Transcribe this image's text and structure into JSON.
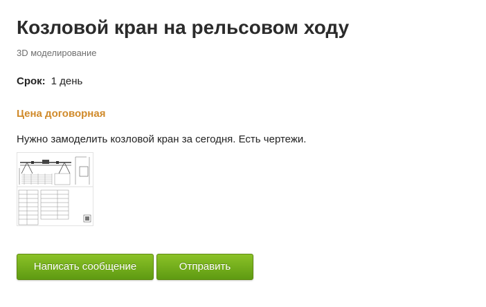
{
  "project": {
    "title": "Козловой кран на рельсовом ходу",
    "category": "3D моделирование",
    "deadline_label": "Срок:",
    "deadline_value": "1 день",
    "price": "Цена договорная",
    "description": "Нужно замоделить козловой кран за сегодня. Есть чертежи."
  },
  "attachment": {
    "icon": "drawing-thumbnail"
  },
  "actions": {
    "message_label": "Написать сообщение",
    "send_label": "Отправить"
  },
  "colors": {
    "accent_button": "#7ab51d",
    "price": "#d08a2a",
    "title": "#2b2b2b",
    "muted": "#6e6e6e"
  }
}
